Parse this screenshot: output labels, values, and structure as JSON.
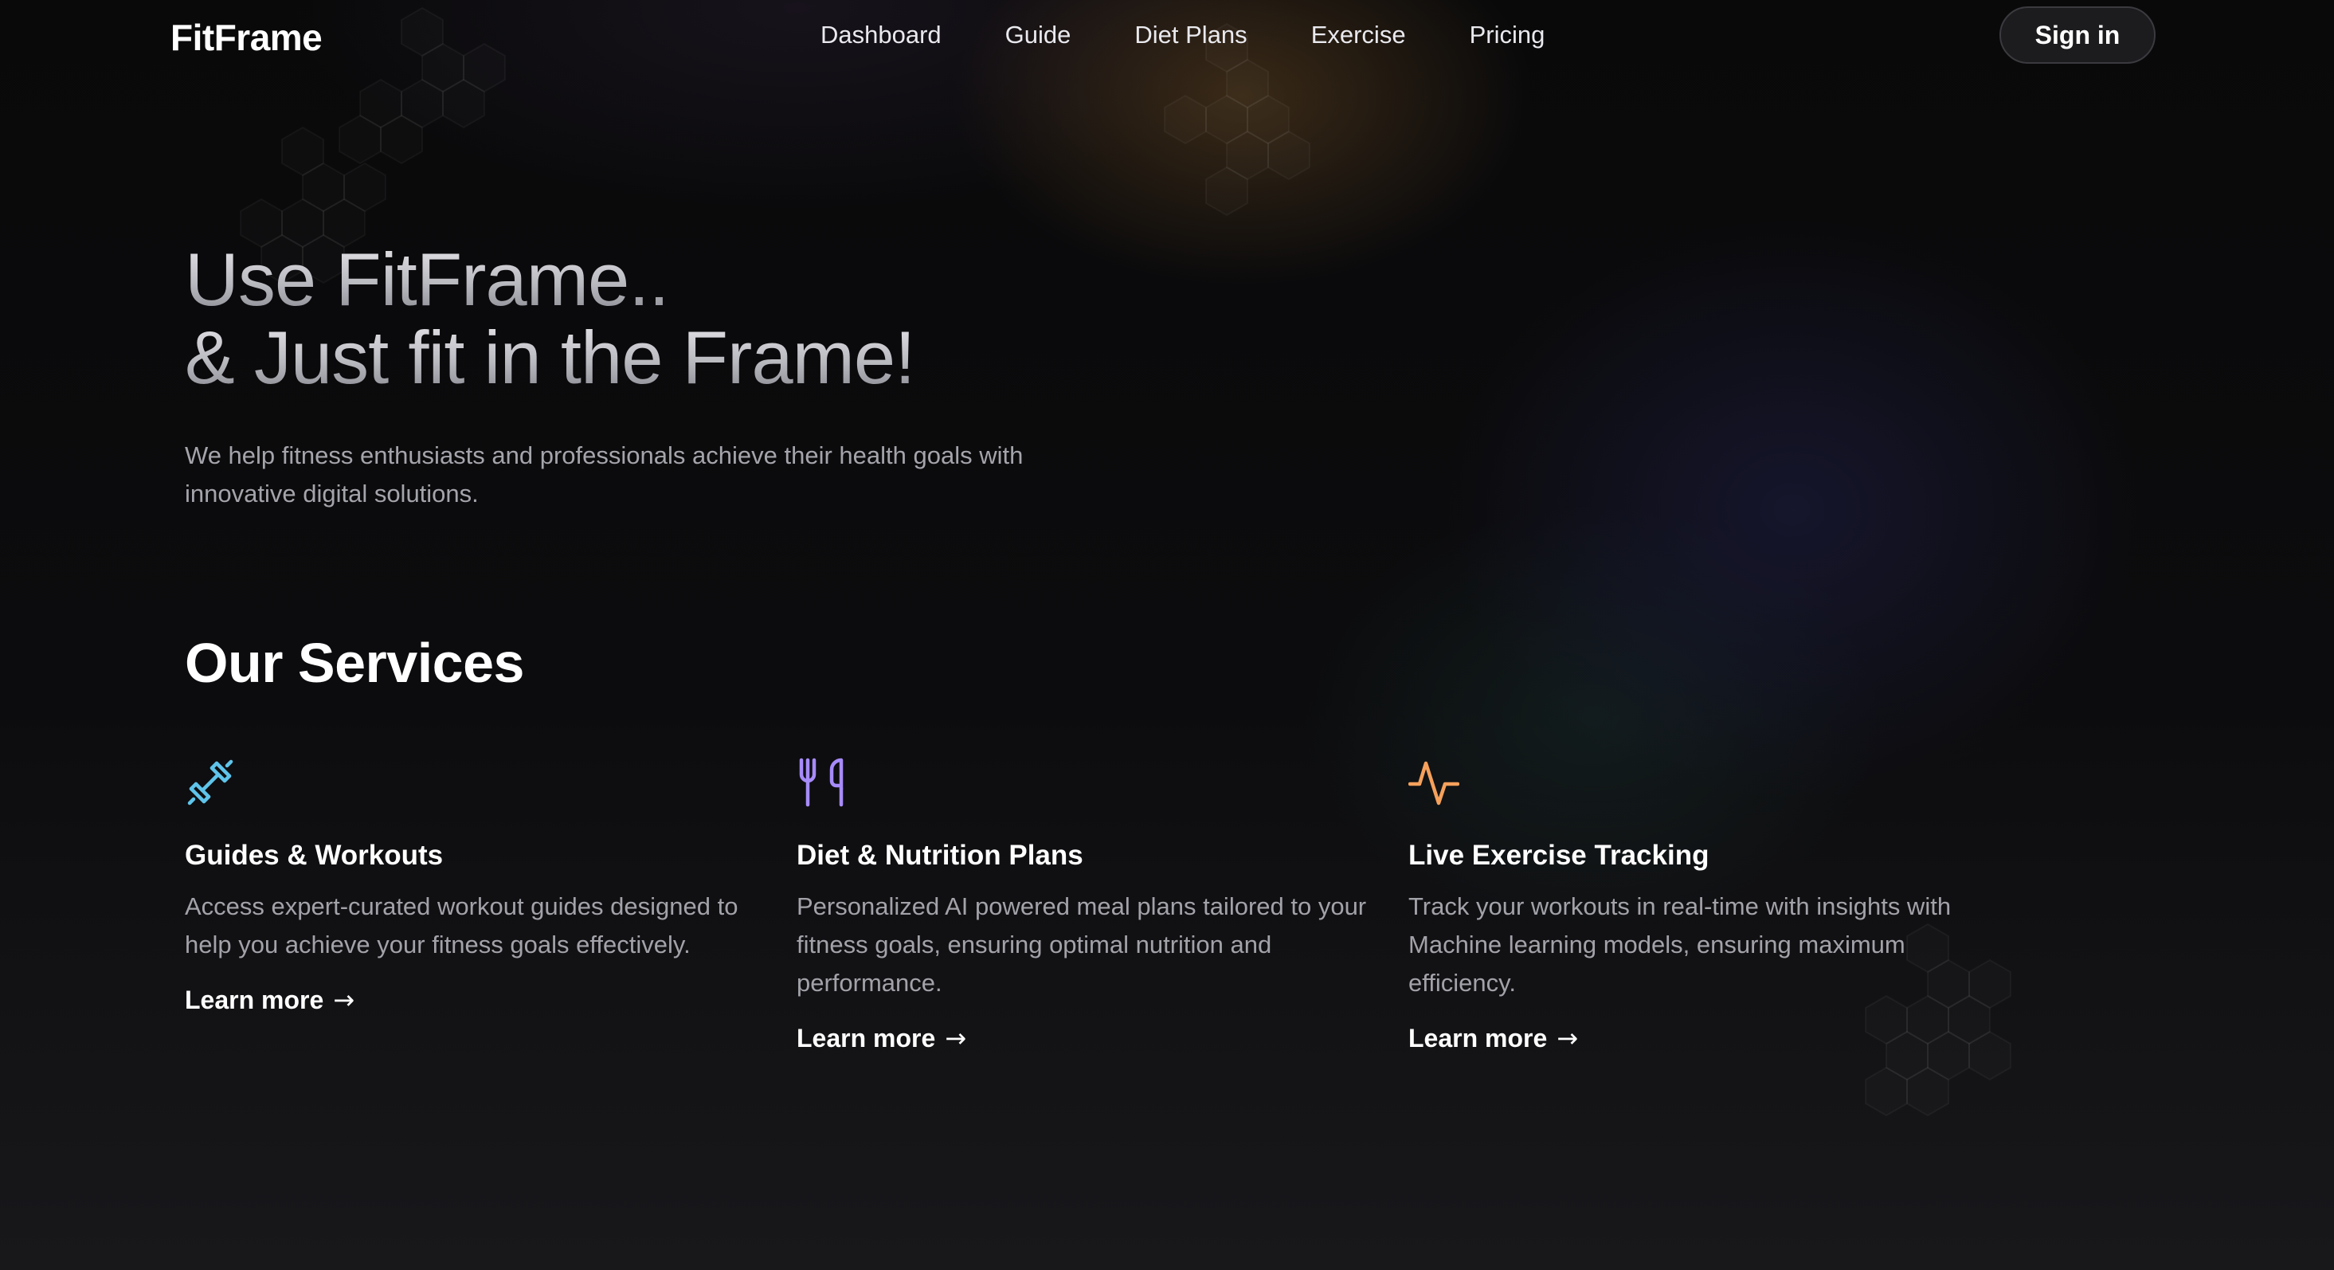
{
  "brand": {
    "name": "FitFrame"
  },
  "nav": {
    "links": [
      "Dashboard",
      "Guide",
      "Diet Plans",
      "Exercise",
      "Pricing"
    ],
    "sign_in": "Sign in"
  },
  "hero": {
    "line1": "Use FitFrame..",
    "line2": "& Just fit in the Frame!",
    "subtitle": "We help fitness enthusiasts and professionals achieve their health goals with innovative digital solutions."
  },
  "services": {
    "title": "Our Services",
    "cards": [
      {
        "icon": "dumbbell-icon",
        "color": "#5fc4ea",
        "title": "Guides & Workouts",
        "description": "Access expert-curated workout guides designed to help you achieve your fitness goals effectively.",
        "link": "Learn more"
      },
      {
        "icon": "utensils-icon",
        "color": "#a78bfa",
        "title": "Diet & Nutrition Plans",
        "description": "Personalized AI powered meal plans tailored to your fitness goals, ensuring optimal nutrition and performance.",
        "link": "Learn more"
      },
      {
        "icon": "activity-icon",
        "color": "#f5a15c",
        "title": "Live Exercise Tracking",
        "description": "Track your workouts in real-time with insights with Machine learning models, ensuring maximum efficiency.",
        "link": "Learn more"
      }
    ]
  }
}
